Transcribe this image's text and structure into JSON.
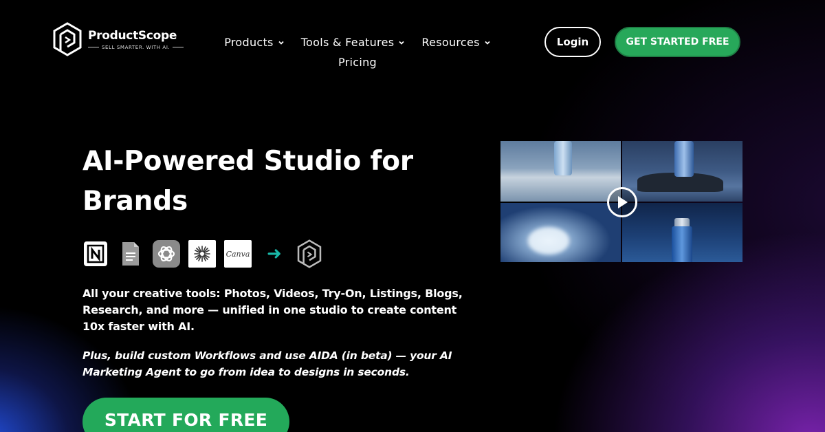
{
  "brand": {
    "name": "ProductScope",
    "tagline": "SELL SMARTER. WITH AI."
  },
  "nav": {
    "items": [
      {
        "label": "Products",
        "icon": "chevron-down-icon"
      },
      {
        "label": "Tools & Features",
        "icon": "chevron-down-icon"
      },
      {
        "label": "Resources",
        "icon": "chevron-down-icon"
      },
      {
        "label": "Pricing"
      }
    ]
  },
  "header": {
    "login_label": "Login",
    "cta_label": "GET STARTED FREE"
  },
  "hero": {
    "title": "AI-Powered Studio for Brands",
    "tools": [
      "notion-icon",
      "google-docs-icon",
      "chatgpt-icon",
      "claude-icon",
      "canva-icon"
    ],
    "canva_text": "Canva",
    "description": "All your creative tools: Photos, Videos, Try-On, Listings, Blogs, Research, and more — unified in one studio to create content 10x faster with AI.",
    "description_2": "Plus, build custom Workflows and use AIDA (in beta) — your AI Marketing Agent to go from idea to designs in seconds.",
    "start_label": "START FOR FREE"
  },
  "colors": {
    "accent_green": "#27a85a",
    "arrow_teal": "#19b7a7",
    "background": "#000000"
  }
}
